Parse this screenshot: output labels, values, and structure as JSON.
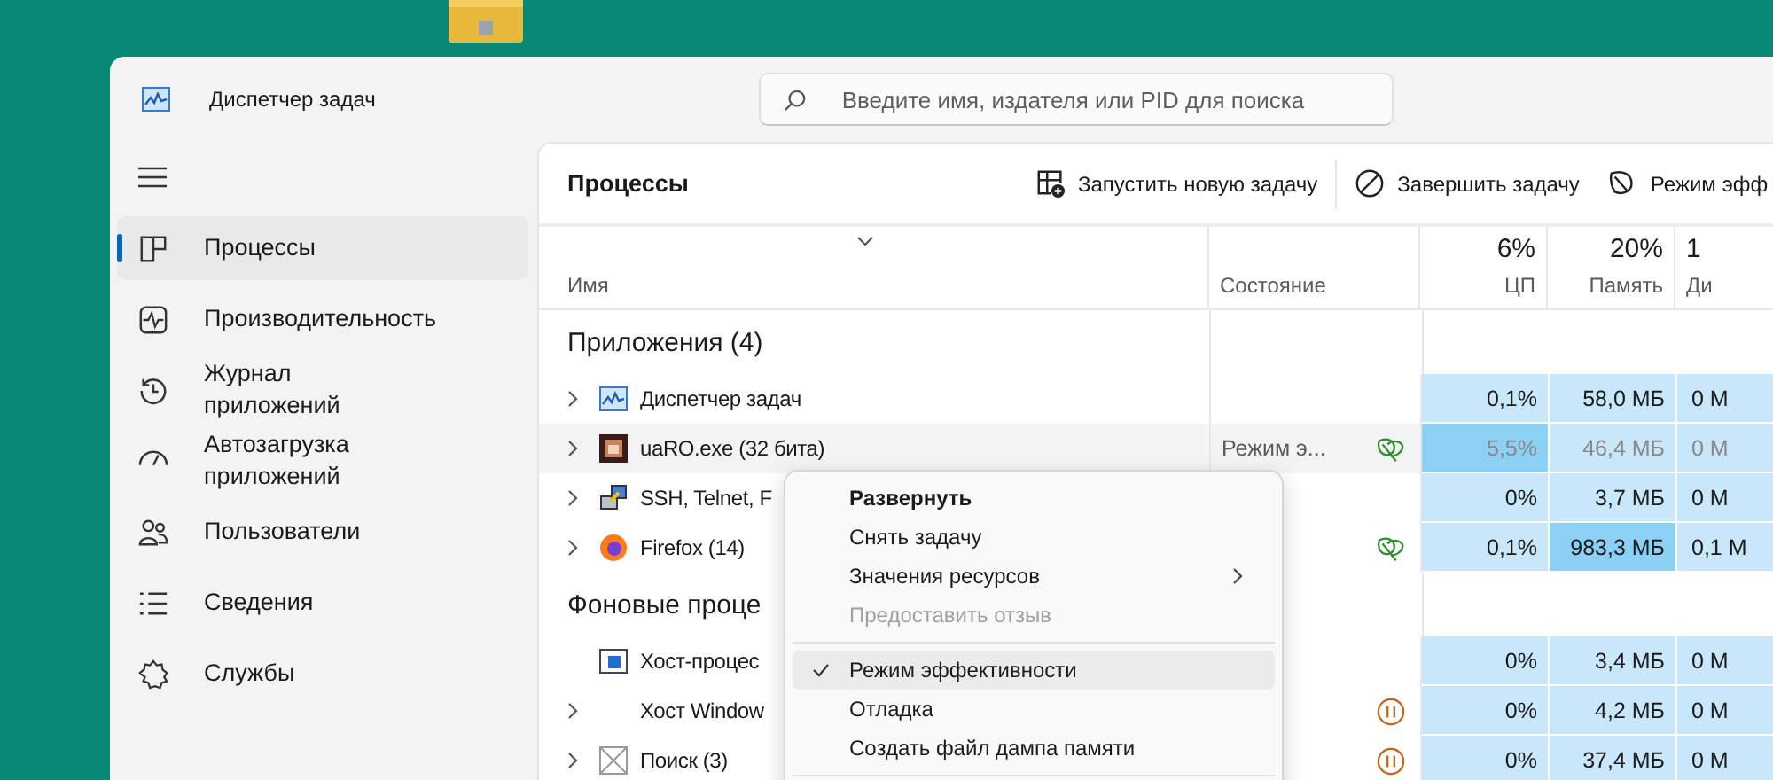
{
  "window": {
    "title": "Диспетчер задач"
  },
  "search": {
    "placeholder": "Введите имя, издателя или PID для поиска"
  },
  "sidebar": {
    "items": [
      {
        "label": "Процессы",
        "kind": "processes",
        "selected": true
      },
      {
        "label": "Производительность",
        "kind": "performance",
        "selected": false
      },
      {
        "label": "Журнал приложений",
        "kind": "history",
        "selected": false
      },
      {
        "label": "Автозагрузка приложений",
        "kind": "startup",
        "selected": false
      },
      {
        "label": "Пользователи",
        "kind": "users",
        "selected": false
      },
      {
        "label": "Сведения",
        "kind": "details",
        "selected": false
      },
      {
        "label": "Службы",
        "kind": "services",
        "selected": false
      }
    ]
  },
  "page_title": "Процессы",
  "toolbar": [
    {
      "label": "Запустить новую задачу",
      "kind": "new"
    },
    {
      "label": "Завершить задачу",
      "kind": "end"
    },
    {
      "label": "Режим эфф",
      "kind": "eco"
    }
  ],
  "table": {
    "columns": [
      {
        "label": "Имя"
      },
      {
        "label": "Состояние"
      },
      {
        "label": "ЦП",
        "total": "6%"
      },
      {
        "label": "Память",
        "total": "20%"
      },
      {
        "label": "Ди",
        "total": "1"
      }
    ],
    "groups": [
      {
        "title": "Приложения (4)",
        "rows": [
          {
            "name": "Диспетчер задач",
            "kind": "monitor",
            "expandable": true,
            "selected": false,
            "dimmed": false,
            "efficiency_mode": false,
            "suspended": false,
            "cells": [
              {
                "text": "0,1%",
                "hot": false
              },
              {
                "text": "58,0 МБ",
                "hot": false
              },
              {
                "text": "0 М",
                "hot": false
              }
            ]
          },
          {
            "name": "uaRO.exe (32 бита)",
            "kind": "game",
            "expandable": true,
            "selected": true,
            "dimmed": true,
            "status": "Режим э...",
            "efficiency_mode": true,
            "suspended": false,
            "cells": [
              {
                "text": "5,5%",
                "hot": true
              },
              {
                "text": "46,4 МБ",
                "hot": false
              },
              {
                "text": "0 М",
                "hot": false
              }
            ]
          },
          {
            "name": "SSH, Telnet, F",
            "kind": "terminal",
            "expandable": true,
            "selected": false,
            "dimmed": false,
            "efficiency_mode": false,
            "suspended": false,
            "cells": [
              {
                "text": "0%",
                "hot": false
              },
              {
                "text": "3,7 МБ",
                "hot": false
              },
              {
                "text": "0 М",
                "hot": false
              }
            ]
          },
          {
            "name": "Firefox (14)",
            "kind": "browser",
            "expandable": true,
            "selected": false,
            "dimmed": false,
            "efficiency_mode": true,
            "suspended": false,
            "cells": [
              {
                "text": "0,1%",
                "hot": false
              },
              {
                "text": "983,3 МБ",
                "hot": true
              },
              {
                "text": "0,1 М",
                "hot": false
              }
            ]
          }
        ]
      },
      {
        "title": "Фоновые проце",
        "rows": [
          {
            "name": "Хост-процес",
            "kind": "window",
            "expandable": false,
            "selected": false,
            "dimmed": false,
            "efficiency_mode": false,
            "suspended": false,
            "cells": [
              {
                "text": "0%",
                "hot": false
              },
              {
                "text": "3,4 МБ",
                "hot": false
              },
              {
                "text": "0 М",
                "hot": false
              }
            ]
          },
          {
            "name": "Хост Window",
            "kind": "none",
            "expandable": true,
            "selected": false,
            "dimmed": false,
            "efficiency_mode": false,
            "suspended": true,
            "cells": [
              {
                "text": "0%",
                "hot": false
              },
              {
                "text": "4,2 МБ",
                "hot": false
              },
              {
                "text": "0 М",
                "hot": false
              }
            ]
          },
          {
            "name": "Поиск (3)",
            "kind": "blank",
            "expandable": true,
            "selected": false,
            "dimmed": false,
            "efficiency_mode": false,
            "suspended": true,
            "cells": [
              {
                "text": "0%",
                "hot": false
              },
              {
                "text": "37,4 МБ",
                "hot": false
              },
              {
                "text": "0 М",
                "hot": false
              }
            ]
          }
        ]
      }
    ]
  },
  "context_menu": {
    "sections": [
      {
        "items": [
          {
            "label": "Развернуть",
            "kind": "default",
            "checked": false,
            "submenu": false,
            "highlighted": false
          },
          {
            "label": "Снять задачу",
            "kind": "normal",
            "checked": false,
            "submenu": false,
            "highlighted": false
          },
          {
            "label": "Значения ресурсов",
            "kind": "normal",
            "checked": false,
            "submenu": true,
            "highlighted": false
          },
          {
            "label": "Предоставить отзыв",
            "kind": "disabled",
            "checked": false,
            "submenu": false,
            "highlighted": false
          }
        ]
      },
      {
        "items": [
          {
            "label": "Режим эффективности",
            "kind": "normal",
            "checked": true,
            "submenu": false,
            "highlighted": true
          },
          {
            "label": "Отладка",
            "kind": "normal",
            "checked": false,
            "submenu": false,
            "highlighted": false
          },
          {
            "label": "Создать файл дампа памяти",
            "kind": "normal",
            "checked": false,
            "submenu": false,
            "highlighted": false
          }
        ]
      }
    ]
  }
}
